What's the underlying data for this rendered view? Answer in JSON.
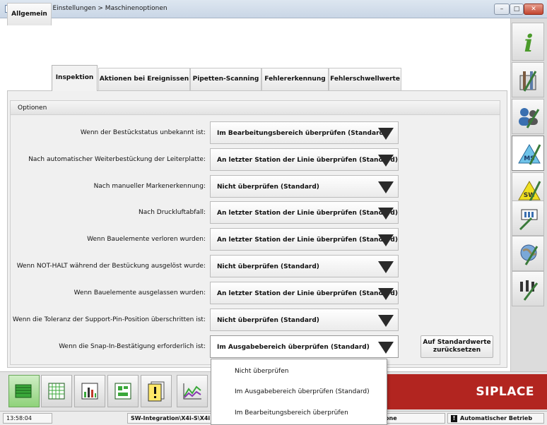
{
  "window": {
    "title": "10.0.277.0 Einstellungen > Maschinenoptionen",
    "min": "–",
    "max": "□",
    "close": "✕"
  },
  "tabs": [
    {
      "label": "Allgemein",
      "active": false
    },
    {
      "label": "Inspektion",
      "active": true
    },
    {
      "label": "Aktionen bei Ereignissen",
      "active": false
    },
    {
      "label": "Pipetten-Scanning",
      "active": false
    },
    {
      "label": "Fehlererkennung",
      "active": false
    },
    {
      "label": "Fehlerschwellwerte",
      "active": false
    }
  ],
  "options": {
    "header": "Optionen",
    "rows": [
      {
        "label": "Wenn der Bestückstatus unbekannt ist:",
        "value": "Im Bearbeitungsbereich überprüfen (Standard)"
      },
      {
        "label": "Nach automatischer Weiterbestückung der Leiterplatte:",
        "value": "An letzter Station der Linie überprüfen (Standard)"
      },
      {
        "label": "Nach manueller Markenerkennung:",
        "value": "Nicht überprüfen (Standard)"
      },
      {
        "label": "Nach Druckluftabfall:",
        "value": "An letzter Station der Linie überprüfen (Standard)"
      },
      {
        "label": "Wenn Bauelemente verloren wurden:",
        "value": "An letzter Station der Linie überprüfen (Standard)"
      },
      {
        "label": "Wenn NOT-HALT während der Bestückung ausgelöst wurde:",
        "value": "Nicht überprüfen (Standard)"
      },
      {
        "label": "Wenn Bauelemente ausgelassen wurden:",
        "value": "An letzter Station der Linie überprüfen (Standard)"
      },
      {
        "label": "Wenn die Toleranz der Support-Pin-Position überschritten ist:",
        "value": "Nicht überprüfen (Standard)"
      },
      {
        "label": "Wenn die Snap-In-Bestätigung erforderlich ist:",
        "value": "Im Ausgabebereich überprüfen (Standard)"
      }
    ],
    "reset_button": "Auf Standardwerte zurücksetzen",
    "open_dropdown_items": [
      "Nicht überprüfen",
      "Im Ausgabebereich überprüfen (Standard)",
      "Im Bearbeitungsbereich überprüfen"
    ]
  },
  "sidebar": {
    "buttons": [
      "info-icon",
      "machine-settings-icon",
      "user-settings-icon",
      "machine-options-icon",
      "software-options-icon",
      "station-settings-icon",
      "network-settings-icon",
      "calibration-icon"
    ],
    "active": "machine-options-icon",
    "info_glyph": "i",
    "ms_glyph": "MS",
    "sw_glyph": "SW"
  },
  "bottombar": {
    "buttons": [
      "production-icon",
      "setup-table-icon",
      "statistics-icon",
      "board-layout-icon",
      "messages-icon",
      "chart-icon"
    ],
    "brand": "SIPLACE"
  },
  "status": {
    "time": "13:58:04",
    "station": "SW-Integration\\X4i-S\\X4i",
    "station_right": "one",
    "mode": "Automatischer Betrieb",
    "mode_icon": "!"
  },
  "colors": {
    "brand_red": "#b22520",
    "active_green": "#8fd27a"
  }
}
